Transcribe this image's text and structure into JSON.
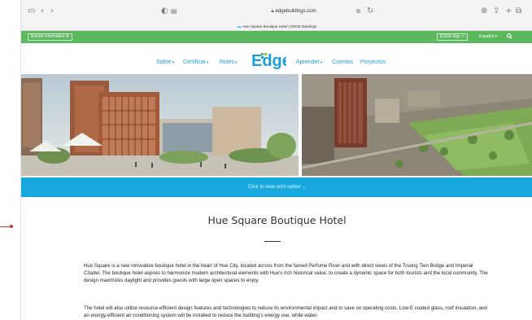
{
  "browser": {
    "url": "edgebuildings.com",
    "tab_title": "Hue Square Boutique Hotel | EDGE Buildings"
  },
  "topbar": {
    "newsletter_label": "Boletín informativo ✉",
    "edge_app_label": "EDGE App ▭",
    "language_label": "Español ▾",
    "search_icon": "search-icon",
    "color": "#5cb85c"
  },
  "nav": {
    "items_left": [
      {
        "label": "Sobre"
      },
      {
        "label": "Certificar"
      },
      {
        "label": "Roles"
      }
    ],
    "logo_text": "Edge",
    "items_right": [
      {
        "label": "Aprender"
      },
      {
        "label": "Cuentos"
      },
      {
        "label": "Proyectos"
      }
    ]
  },
  "print_bar": {
    "label": "Click to view print option ⌄",
    "color": "#17a8e0"
  },
  "content": {
    "title": "Hue Square Boutique Hotel",
    "paragraph1": "Hue Square is a new innovative boutique hotel in the heart of Hue City, located across from the famed Perfume River and with direct views of the Truong Tien Bridge and Imperial Citadel. The boutique hotel aspires to harmonize modern architectural elements with Hue's rich historical value; to create a dynamic space for both tourists and the local community. The design maximizes daylight and provides guests with large open spaces to enjoy.",
    "paragraph2": "The hotel will also utilize resource-efficient design features and technologies to reduce its environmental impact and to save on operating costs. Low-E coated glass, roof insulation, and an energy-efficient air conditioning system will be installed to reduce the building's energy use, while water-"
  }
}
